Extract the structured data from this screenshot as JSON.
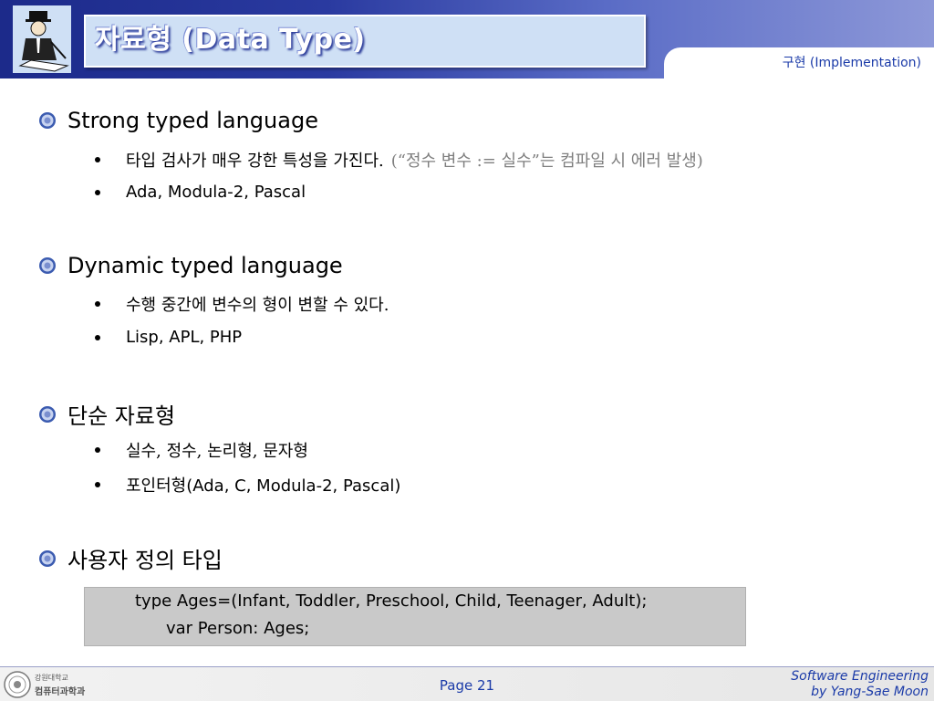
{
  "header": {
    "title": "자료형 (Data Type)",
    "section_label": "구현 (Implementation)"
  },
  "sections": [
    {
      "heading": "Strong typed language",
      "items": [
        {
          "text": "타입 검사가 매우 강한 특성을 가진다.",
          "note": "(“정수 변수 := 실수”는 컴파일 시 에러 발생)"
        },
        {
          "text": "Ada, Modula-2, Pascal"
        }
      ]
    },
    {
      "heading": "Dynamic typed language",
      "items": [
        {
          "text": "수행 중간에 변수의 형이 변할 수 있다."
        },
        {
          "text": "Lisp, APL, PHP"
        }
      ]
    },
    {
      "heading": "단순 자료형",
      "items": [
        {
          "text": "실수, 정수, 논리형, 문자형"
        },
        {
          "text": "포인터형(Ada, C, Modula-2, Pascal)"
        }
      ]
    },
    {
      "heading": "사용자 정의 타입",
      "items": []
    }
  ],
  "code": {
    "line1": "type Ages=(Infant, Toddler, Preschool, Child, Teenager, Adult);",
    "line2": "var Person: Ages;"
  },
  "footer": {
    "logo_text_1": "강원대학교",
    "logo_text_2": "컴퓨터과학과",
    "page": "Page 21",
    "course": "Software Engineering",
    "author": "by Yang-Sae Moon"
  },
  "colors": {
    "header_dark": "#1c2a8a",
    "accent_blue": "#1a3aa8",
    "code_bg": "#c9c9c9"
  },
  "icons": {
    "logo": "teacher-pointer-icon",
    "bullet": "seal-bullet-icon",
    "footer_logo": "university-seal-icon"
  }
}
